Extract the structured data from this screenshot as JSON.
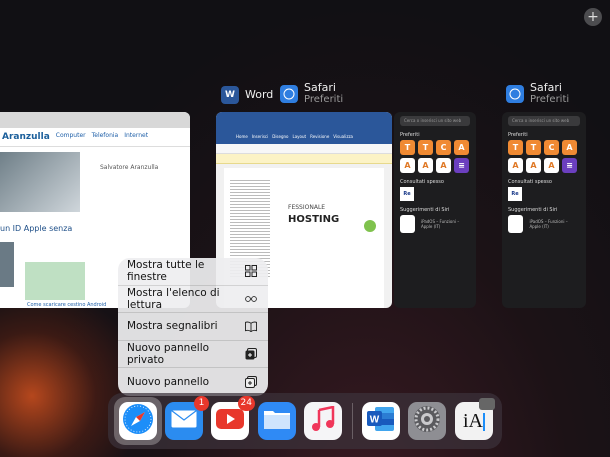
{
  "switcher": {
    "add_button": "+",
    "apps": [
      {
        "name": "Word",
        "subtitle": ""
      },
      {
        "name": "Safari",
        "subtitle": "Preferiti"
      },
      {
        "name": "Safari",
        "subtitle": "Preferiti"
      }
    ]
  },
  "card_article": {
    "brand": "Aranzulla",
    "nav": [
      "Computer",
      "Telefonia",
      "Internet"
    ],
    "author": "Salvatore Aranzulla",
    "headline": "un ID Apple senza",
    "caption": "Come scaricare cestino Android"
  },
  "card_word": {
    "title": "Word",
    "tabs": [
      "Home",
      "Inserisci",
      "Disegno",
      "Layout",
      "Revisione",
      "Visualizza"
    ],
    "hosting_text": "HOSTING",
    "pre_text": "FESSIONALE"
  },
  "safari_panel": {
    "search_placeholder": "Cerca o inserisci un sito web",
    "favorites_label": "Preferiti",
    "show_all": "Mostra altri",
    "frequent_label": "Consultati spesso",
    "siri_label": "Suggerimenti di Siri",
    "siri_item": "iPadOS – Funzioni – Apple (IT)",
    "show_label": "Visualizza",
    "tiles": [
      "T",
      "T",
      "C",
      "A",
      "A",
      "A",
      "A",
      "A",
      "≡"
    ]
  },
  "context_menu": {
    "items": [
      {
        "label": "Mostra tutte le finestre",
        "icon": "grid-icon"
      },
      {
        "label": "Mostra l'elenco di lettura",
        "icon": "glasses-icon"
      },
      {
        "label": "Mostra segnalibri",
        "icon": "book-icon"
      },
      {
        "label": "Nuovo pannello privato",
        "icon": "private-tab-icon"
      },
      {
        "label": "Nuovo pannello",
        "icon": "new-tab-icon"
      }
    ]
  },
  "dock": {
    "apps": [
      {
        "name": "Safari",
        "icon": "safari-icon",
        "color": "#1c8ef9"
      },
      {
        "name": "Mail",
        "icon": "mail-icon",
        "color": "#2b8cf0",
        "badge": "1"
      },
      {
        "name": "YouTube",
        "icon": "youtube-icon",
        "color": "#ffffff",
        "badge": "24"
      },
      {
        "name": "Files",
        "icon": "files-icon",
        "color": "#2f8af5"
      },
      {
        "name": "Music",
        "icon": "music-icon",
        "color": "#f5f5f7"
      },
      {
        "name": "Word",
        "icon": "word-icon",
        "color": "#2b579a"
      },
      {
        "name": "Settings",
        "icon": "settings-icon",
        "color": "#8e8e93"
      },
      {
        "name": "iA Writer",
        "icon": "ia-writer-icon",
        "color": "#f2f2f2"
      }
    ]
  }
}
